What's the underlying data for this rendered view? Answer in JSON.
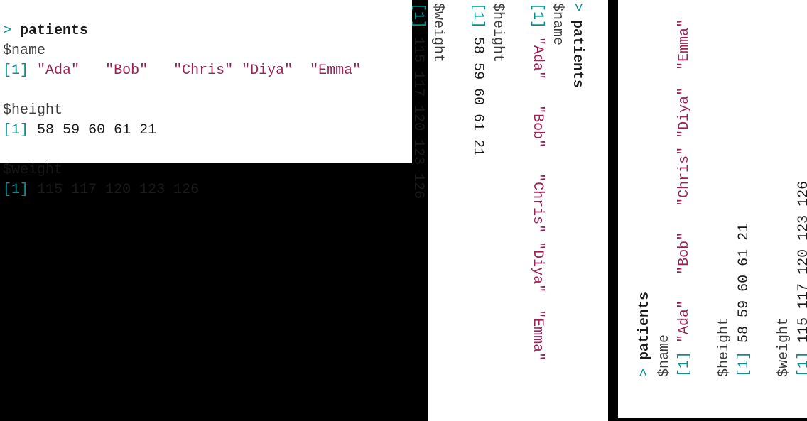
{
  "console": {
    "prompt": ">",
    "command": "patients",
    "attrs": {
      "name_label": "$name",
      "height_label": "$height",
      "weight_label": "$weight"
    },
    "index": "[1]",
    "name": {
      "v1": "\"Ada\"",
      "v2": "\"Bob\"",
      "v3": "\"Chris\"",
      "v4": "\"Diya\"",
      "v5": "\"Emma\""
    },
    "height": {
      "v1": "58",
      "v2": "59",
      "v3": "60",
      "v4": "61",
      "v5": "21"
    },
    "weight": {
      "v1": "115",
      "v2": "117",
      "v3": "120",
      "v4": "123",
      "v5": "126"
    }
  }
}
